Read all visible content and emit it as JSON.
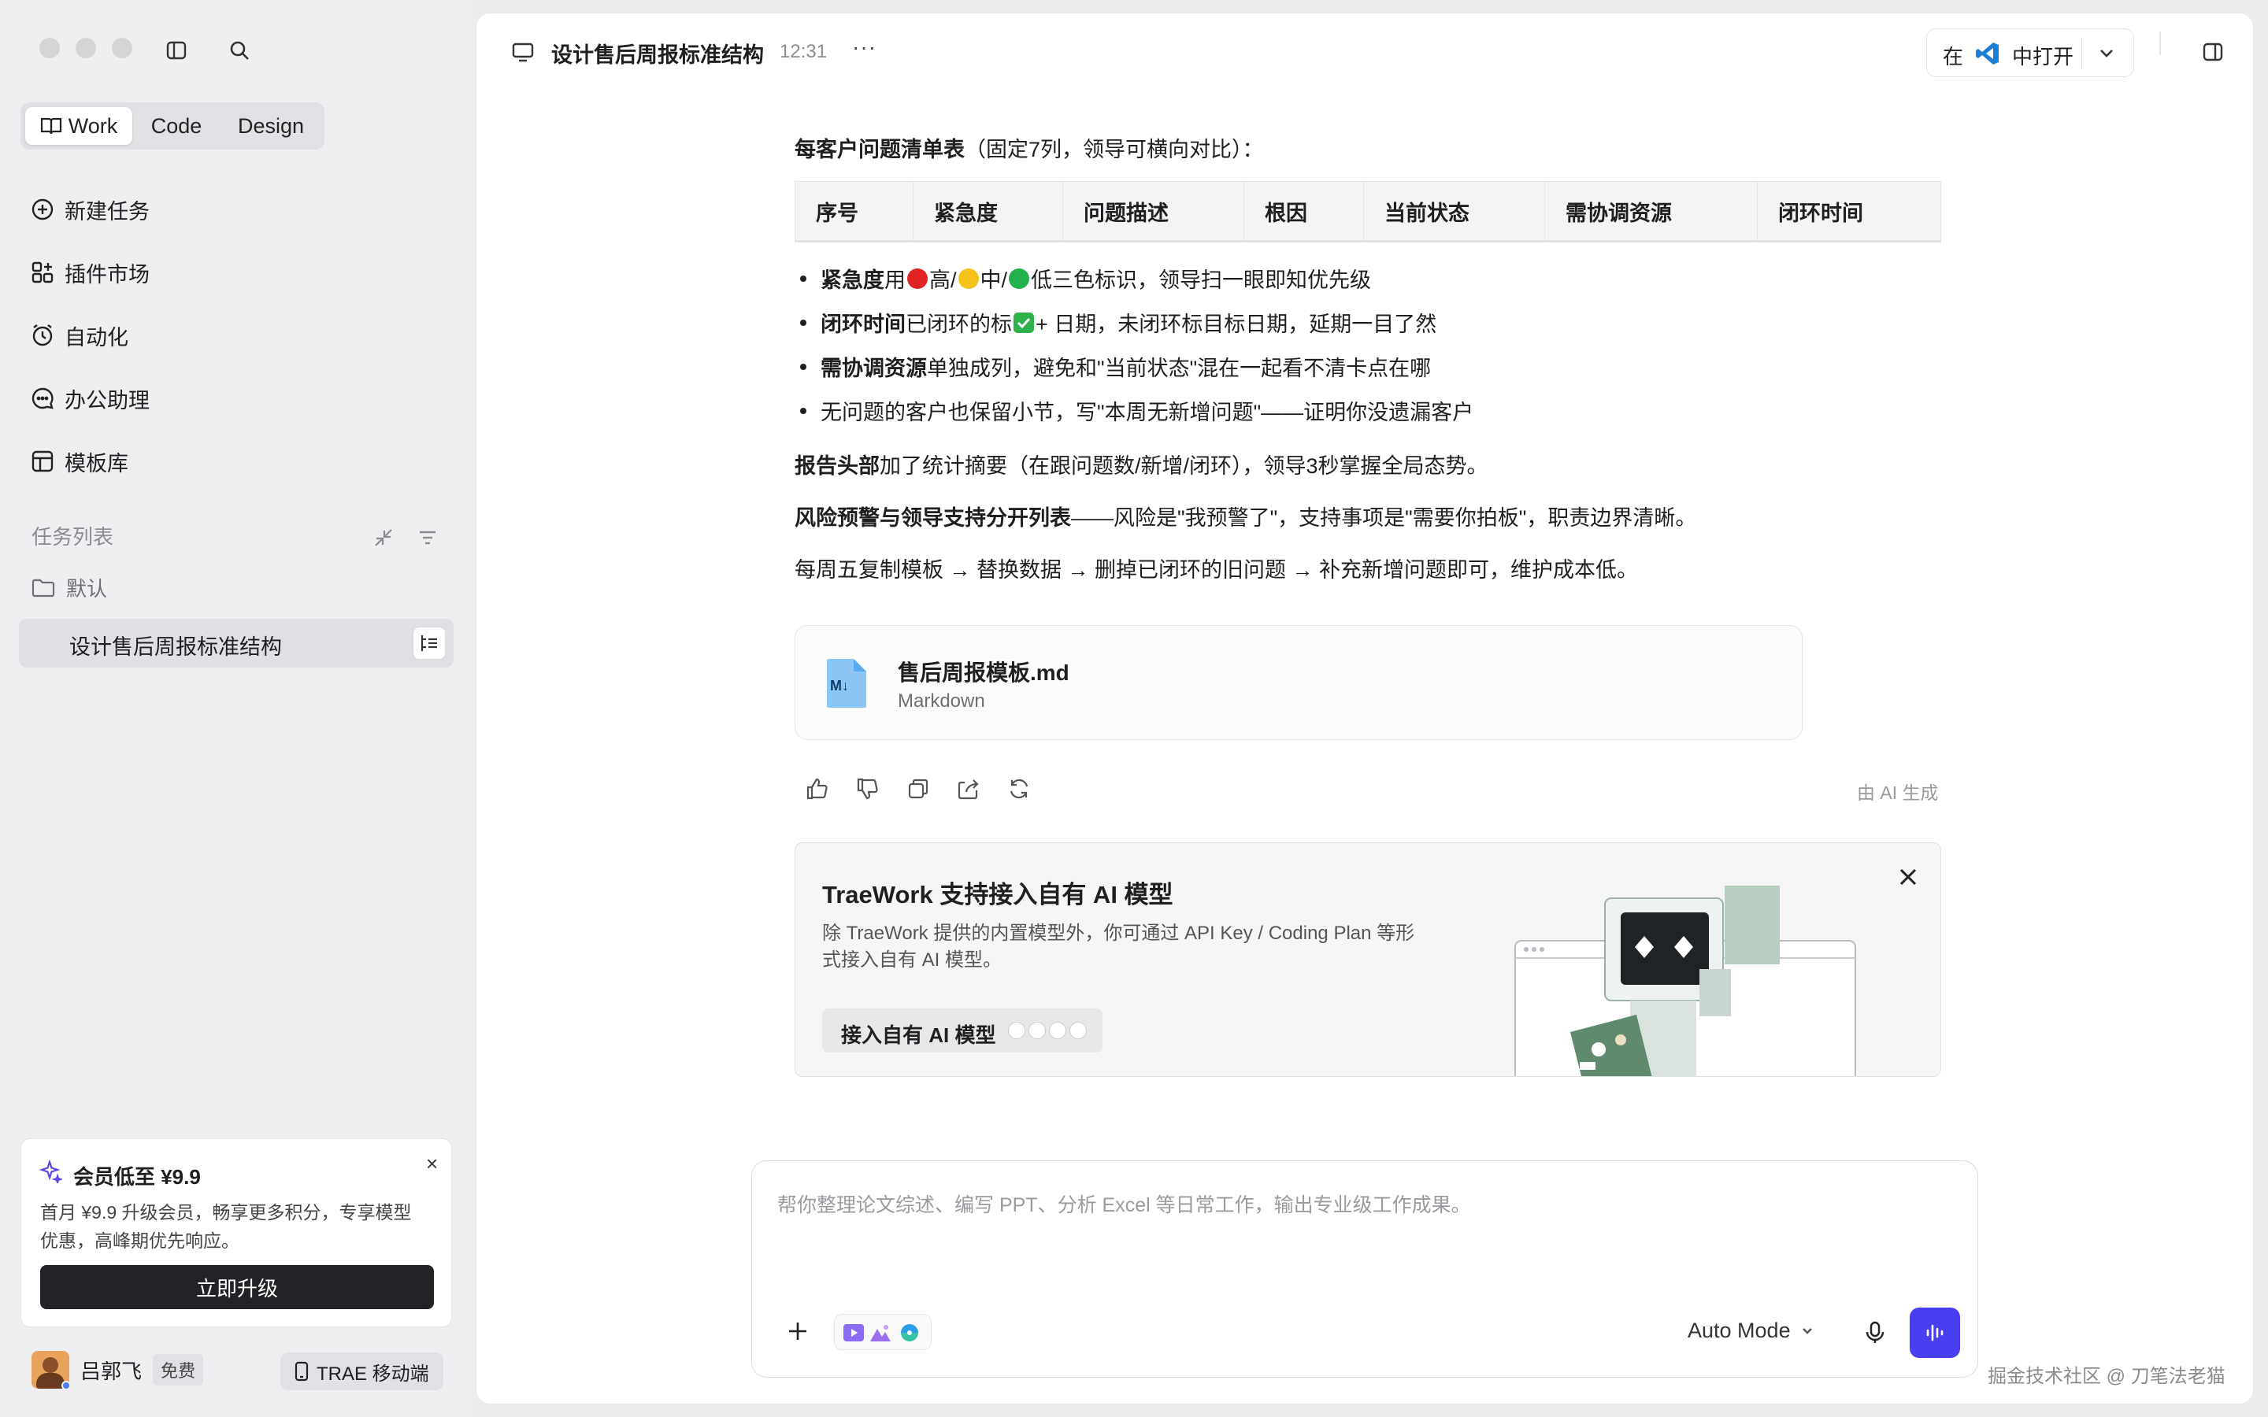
{
  "sidebar": {
    "modes": [
      "Work",
      "Code",
      "Design"
    ],
    "nav": [
      "新建任务",
      "插件市场",
      "自动化",
      "办公助理",
      "模板库"
    ],
    "task_list_label": "任务列表",
    "folder_label": "默认",
    "active_task": "设计售后周报标准结构",
    "promo": {
      "title": "会员低至 ¥9.9",
      "line1": "首月 ¥9.9 升级会员，畅享更多积分，专享模型",
      "line2": "优惠，高峰期优先响应。",
      "button": "立即升级",
      "close": "×"
    },
    "user": {
      "name": "吕郭飞",
      "plan": "免费",
      "mobile": "TRAE 移动端"
    }
  },
  "header": {
    "title": "设计售后周报标准结构",
    "time": "12:31",
    "more": "···",
    "open_in_prefix": "在",
    "open_in_suffix": "中打开"
  },
  "content": {
    "intro_bold": "每客户问题清单表",
    "intro_rest": "（固定7列，领导可横向对比）：",
    "table_headers": [
      "序号",
      "紧急度",
      "问题描述",
      "根因",
      "当前状态",
      "需协调资源",
      "闭环时间"
    ],
    "bullets": [
      {
        "bold": "紧急度",
        "parts": [
          "用",
          "高/",
          "中/",
          "低三色标识，领导扫一眼即知优先级"
        ]
      },
      {
        "bold": "闭环时间",
        "parts": [
          "已闭环的标 ",
          " + 日期，未闭环标目标日期，延期一目了然"
        ]
      },
      {
        "bold": "需协调资源",
        "parts": [
          "单独成列，避免和\"当前状态\"混在一起看不清卡点在哪"
        ]
      },
      {
        "bold": "",
        "parts": [
          "无问题的客户也保留小节，写\"本周无新增问题\"——证明你没遗漏客户"
        ]
      }
    ],
    "para1_bold": "报告头部",
    "para1_rest": "加了统计摘要（在跟问题数/新增/闭环），领导3秒掌握全局态势。",
    "para2_bold": "风险预警与领导支持分开列表",
    "para2_rest": "——风险是\"我预警了\"，支持事项是\"需要你拍板\"，职责边界清晰。",
    "para3": "每周五复制模板 → 替换数据 → 删掉已闭环的旧问题 → 补充新增问题即可，维护成本低。",
    "file": {
      "name": "售后周报模板.md",
      "type": "Markdown",
      "icon_text": "M↓"
    },
    "ai_label": "由 AI 生成",
    "banner": {
      "title": "TraeWork 支持接入自有 AI 模型",
      "line1": "除 TraeWork 提供的内置模型外，你可通过 API Key / Coding Plan 等形",
      "line2": "式接入自有 AI 模型。",
      "button": "接入自有 AI 模型"
    }
  },
  "composer": {
    "placeholder": "帮你整理论文综述、编写 PPT、分析 Excel 等日常工作，输出专业级工作成果。",
    "mode": "Auto Mode"
  },
  "watermark": "掘金技术社区 @ 刀笔法老猫",
  "colors": {
    "accent": "#4a3ff0",
    "dark_button": "#222326",
    "red": "#e02424",
    "yellow": "#f4c21a",
    "green": "#22b14c"
  }
}
